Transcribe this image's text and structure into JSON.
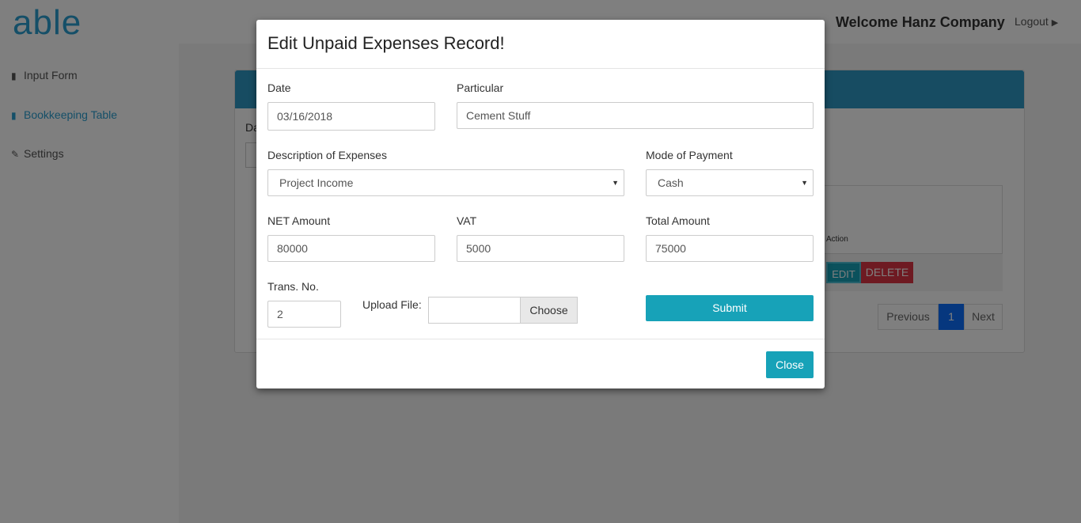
{
  "app": {
    "logo": "able"
  },
  "header": {
    "welcome": "Welcome Hanz Company",
    "logout": "Logout",
    "logout_icon": "sign-out-icon"
  },
  "sidebar": {
    "items": [
      {
        "label": "Input Form",
        "icon": "file-icon",
        "glyph": "▮"
      },
      {
        "label": "Bookkeeping Table",
        "icon": "file-icon",
        "glyph": "▮"
      },
      {
        "label": "Settings",
        "icon": "wrench-icon",
        "glyph": "✎"
      }
    ]
  },
  "background": {
    "date_label_partial": "Da",
    "table_action_header": "Action",
    "edit_label": "EDIT",
    "delete_label": "DELETE",
    "pager": {
      "previous": "Previous",
      "page": "1",
      "next": "Next"
    }
  },
  "modal": {
    "title": "Edit Unpaid Expenses Record!",
    "date": {
      "label": "Date",
      "value": "03/16/2018"
    },
    "particular": {
      "label": "Particular",
      "value": "Cement Stuff"
    },
    "description": {
      "label": "Description of Expenses",
      "value": "Project Income"
    },
    "mode": {
      "label": "Mode of Payment",
      "value": "Cash"
    },
    "net": {
      "label": "NET Amount",
      "value": "80000"
    },
    "vat": {
      "label": "VAT",
      "value": "5000"
    },
    "total": {
      "label": "Total Amount",
      "value": "75000"
    },
    "trans": {
      "label": "Trans. No.",
      "value": "2"
    },
    "upload": {
      "label": "Upload File:",
      "button": "Choose"
    },
    "submit_label": "Submit",
    "close_label": "Close"
  },
  "colors": {
    "accent": "#17a2b8",
    "brand": "#2b9fd1",
    "danger": "#dc3545",
    "primary": "#0d6efd"
  }
}
